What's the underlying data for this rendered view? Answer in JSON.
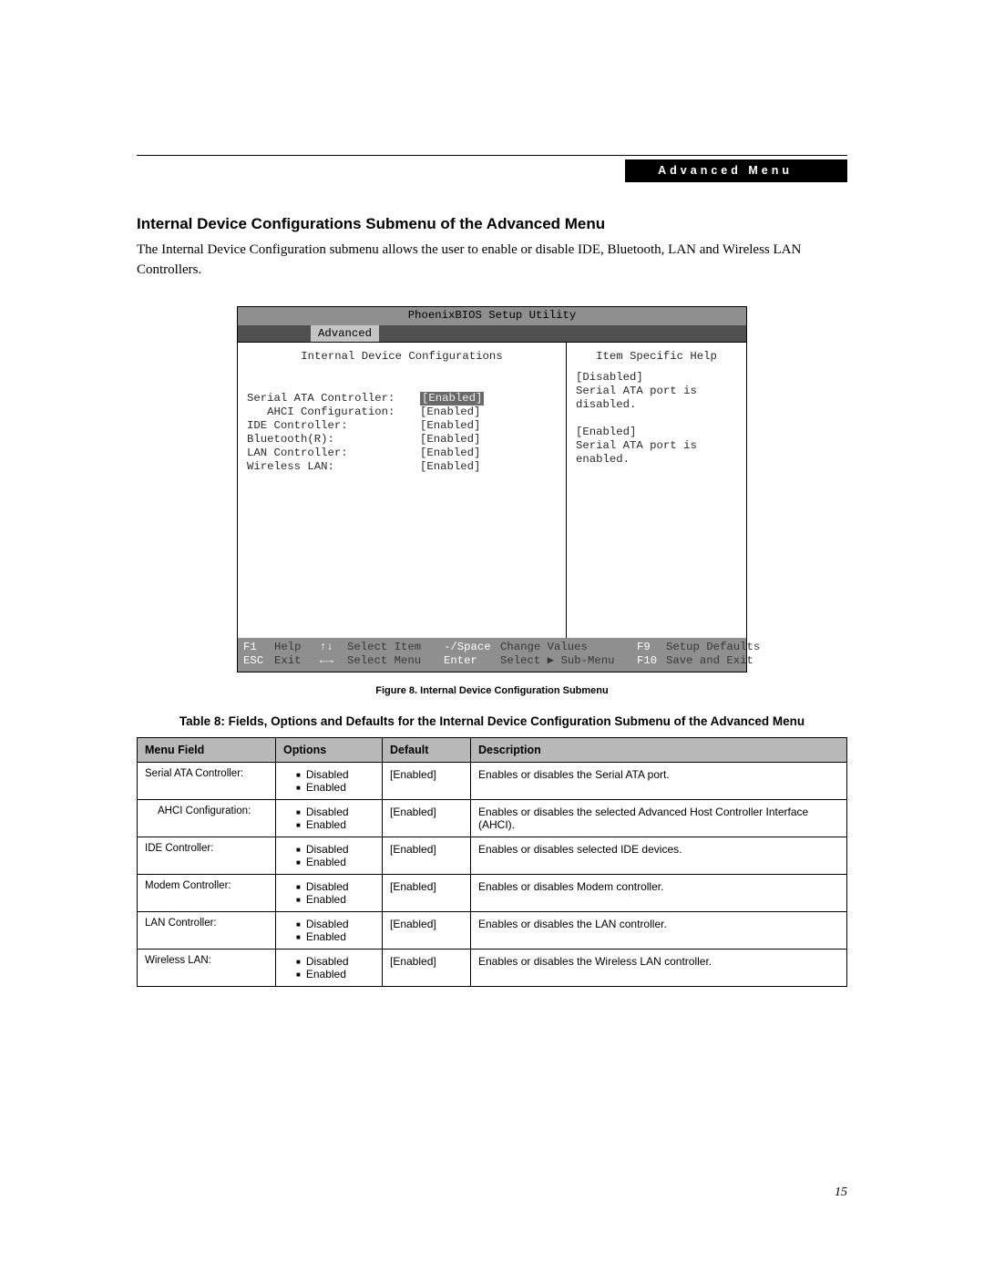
{
  "section_bar": "Advanced Menu",
  "heading": "Internal Device Configurations Submenu of the Advanced Menu",
  "intro": "The Internal Device Configuration submenu allows the user to enable or disable IDE, Bluetooth, LAN and Wireless LAN Controllers.",
  "bios": {
    "title": "PhoenixBIOS Setup Utility",
    "tab": "Advanced",
    "left_header": "Internal Device Configurations",
    "right_header": "Item Specific Help",
    "fields": [
      {
        "label": "Serial ATA Controller:",
        "value": "[Enabled]",
        "selected": true
      },
      {
        "label": "   AHCI Configuration:",
        "value": "[Enabled]",
        "selected": false
      },
      {
        "label": "IDE Controller:",
        "value": "[Enabled]",
        "selected": false
      },
      {
        "label": "Bluetooth(R):",
        "value": "[Enabled]",
        "selected": false
      },
      {
        "label": "LAN Controller:",
        "value": "[Enabled]",
        "selected": false
      },
      {
        "label": "Wireless LAN:",
        "value": "[Enabled]",
        "selected": false
      }
    ],
    "help": "[Disabled]\nSerial ATA port is\ndisabled.\n\n[Enabled]\nSerial ATA port is\nenabled.",
    "footer": {
      "r1": {
        "k1": "F1",
        "l1": "Help",
        "k2": "↑↓",
        "l2": "Select Item",
        "k3": "-/Space",
        "l3": "Change Values",
        "k4": "F9",
        "l4": "Setup Defaults"
      },
      "r2": {
        "k1": "ESC",
        "l1": "Exit",
        "k2": "←→",
        "l2": "Select Menu",
        "k3": "Enter",
        "l3": "Select ▶ Sub-Menu",
        "k4": "F10",
        "l4": "Save and Exit"
      }
    }
  },
  "figure_caption": "Figure 8.  Internal Device Configuration Submenu",
  "table_caption": "Table 8: Fields, Options and Defaults for the Internal Device Configuration Submenu of the Advanced Menu",
  "table": {
    "headers": {
      "menu": "Menu Field",
      "options": "Options",
      "def": "Default",
      "desc": "Description"
    },
    "rows": [
      {
        "menu": "Serial ATA Controller:",
        "indent": false,
        "opts": [
          "Disabled",
          "Enabled"
        ],
        "def": "[Enabled]",
        "desc": "Enables or disables the Serial ATA port."
      },
      {
        "menu": "AHCI Configuration:",
        "indent": true,
        "opts": [
          "Disabled",
          "Enabled"
        ],
        "def": "[Enabled]",
        "desc": "Enables or disables the selected Advanced Host Controller Interface (AHCI)."
      },
      {
        "menu": "IDE Controller:",
        "indent": false,
        "opts": [
          "Disabled",
          "Enabled"
        ],
        "def": "[Enabled]",
        "desc": "Enables or disables selected IDE devices."
      },
      {
        "menu": "Modem Controller:",
        "indent": false,
        "opts": [
          "Disabled",
          "Enabled"
        ],
        "def": "[Enabled]",
        "desc": "Enables or disables Modem controller."
      },
      {
        "menu": "LAN Controller:",
        "indent": false,
        "opts": [
          "Disabled",
          "Enabled"
        ],
        "def": "[Enabled]",
        "desc": "Enables or disables the LAN controller."
      },
      {
        "menu": "Wireless LAN:",
        "indent": false,
        "opts": [
          "Disabled",
          "Enabled"
        ],
        "def": "[Enabled]",
        "desc": "Enables or disables the Wireless LAN controller."
      }
    ]
  },
  "page_number": "15"
}
